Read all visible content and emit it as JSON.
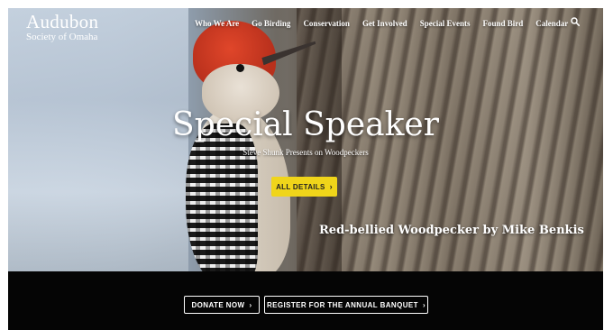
{
  "header": {
    "logo_title": "Audubon",
    "logo_subtitle": "Society of Omaha",
    "nav": [
      "Who We Are",
      "Go Birding",
      "Conservation",
      "Get Involved",
      "Special Events",
      "Found Bird",
      "Calendar"
    ],
    "search_icon": "search-icon"
  },
  "hero": {
    "title": "Special Speaker",
    "subtitle": "Steve Shunk Presents on Woodpeckers",
    "button_label": "ALL DETAILS",
    "caption": "Red-bellied Woodpecker by Mike Benkis"
  },
  "cta": {
    "donate_label": "DONATE NOW",
    "register_label": "REGISTER FOR THE ANNUAL BANQUET"
  },
  "colors": {
    "accent_button": "#f0d51a",
    "bar_background": "#050505"
  }
}
